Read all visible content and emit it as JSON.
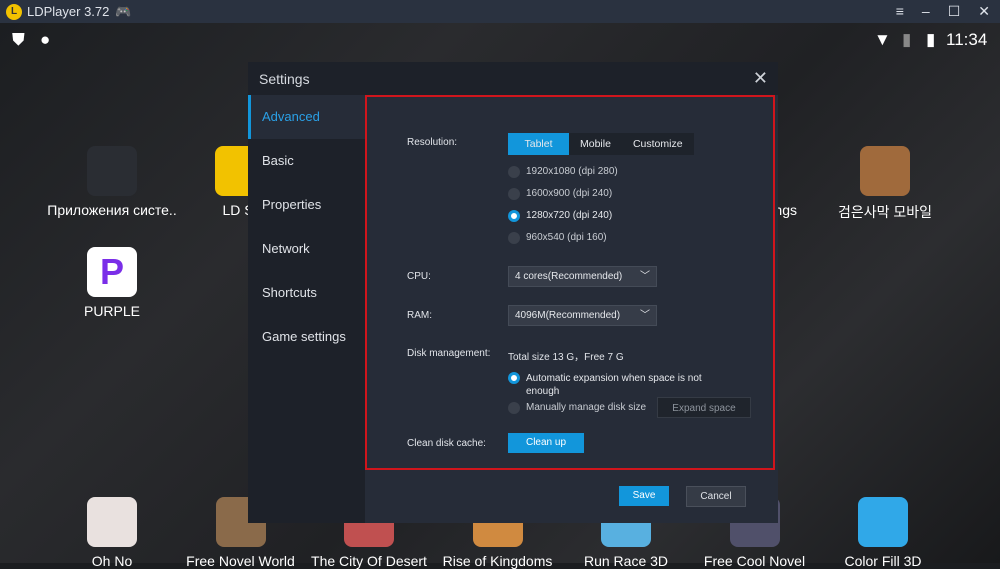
{
  "window": {
    "title": "LDPlayer 3.72",
    "controls": [
      "≡",
      "–",
      "☐",
      "✕"
    ]
  },
  "statusbar": {
    "time": "11:34"
  },
  "desktop": {
    "apps_top": [
      {
        "label": "Приложения систе..",
        "color": "#2a2d33"
      },
      {
        "label": "LD St",
        "color": "#f2c200"
      },
      {
        "label": "ngs",
        "color": "#555"
      },
      {
        "label": "검은사막 모바일",
        "color": "#a06a3c"
      },
      {
        "label": "PURPLE",
        "color": "#ffffff"
      }
    ],
    "apps_bottom": [
      {
        "label": "Oh No",
        "color": "#e9e1df"
      },
      {
        "label": "Free Novel World",
        "color": "#8a6a4a"
      },
      {
        "label": "The City Of Desert",
        "color": "#c05050"
      },
      {
        "label": "Rise of Kingdoms",
        "color": "#d08a40"
      },
      {
        "label": "Run Race 3D",
        "color": "#58b0e0"
      },
      {
        "label": "Free Cool Novel",
        "color": "#50506a"
      },
      {
        "label": "Color Fill 3D",
        "color": "#30a8e8"
      }
    ]
  },
  "dialog": {
    "title": "Settings",
    "close": "✕",
    "tabs": [
      "Advanced",
      "Basic",
      "Properties",
      "Network",
      "Shortcuts",
      "Game settings"
    ],
    "active_tab": "Advanced",
    "resolution": {
      "label": "Resolution:",
      "modes": [
        "Tablet",
        "Mobile",
        "Customize"
      ],
      "selected_mode": "Tablet",
      "options": [
        "1920x1080  (dpi 280)",
        "1600x900  (dpi 240)",
        "1280x720  (dpi 240)",
        "960x540  (dpi 160)"
      ],
      "selected": "1280x720  (dpi 240)"
    },
    "cpu": {
      "label": "CPU:",
      "value": "4 cores(Recommended)"
    },
    "ram": {
      "label": "RAM:",
      "value": "4096M(Recommended)"
    },
    "disk": {
      "label": "Disk management:",
      "info": "Total size 13 G，Free 7 G",
      "auto": "Automatic expansion when space is not enough",
      "manual": "Manually manage disk size",
      "expand": "Expand space",
      "selected": "auto"
    },
    "cache": {
      "label": "Clean disk cache:",
      "button": "Clean up"
    },
    "save": "Save",
    "cancel": "Cancel"
  },
  "colors": {
    "accent": "#1296db",
    "highlight_border": "#d0151c"
  }
}
